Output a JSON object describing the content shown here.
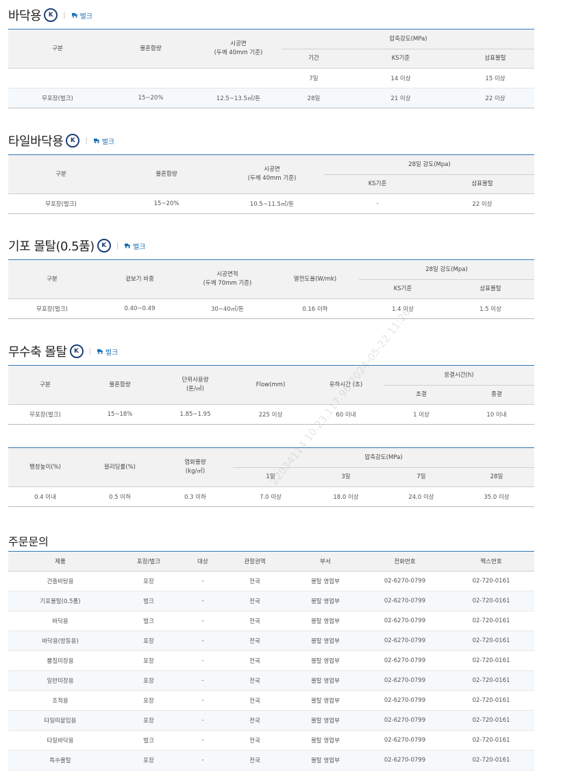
{
  "sections": {
    "floor": {
      "title": "바닥용",
      "ks": "K",
      "bulk": "벌크",
      "headers": {
        "category": "구분",
        "water": "물혼합량",
        "area_line1": "시공면",
        "area_line2": "(두께 40mm 기준)",
        "strength": "압축강도(MPa)",
        "period": "기간",
        "ks_std": "KS기준",
        "sampyo": "삼표몰탈"
      },
      "rows": [
        {
          "category": "",
          "water": "",
          "area": "",
          "period": "7일",
          "ks_std": "14 이상",
          "sampyo": "15 이상"
        },
        {
          "category": "무포장(벌크)",
          "water": "15~20%",
          "area": "12.5~13.5㎡/톤",
          "period": "28일",
          "ks_std": "21 이상",
          "sampyo": "22 이상"
        }
      ]
    },
    "tile_floor": {
      "title": "타일바닥용",
      "ks": "K",
      "bulk": "벌크",
      "headers": {
        "category": "구분",
        "water": "물혼합량",
        "area_line1": "시공면",
        "area_line2": "(두께 40mm 기준)",
        "strength": "28일 강도(Mpa)",
        "ks_std": "KS기준",
        "sampyo": "삼표몰탈"
      },
      "row": {
        "category": "무포장(벌크)",
        "water": "15~20%",
        "area": "10.5~11.5㎡/톤",
        "ks_std": "-",
        "sampyo": "22 이상"
      }
    },
    "base": {
      "title": "기포 몰탈(0.5품)",
      "ks": "K",
      "bulk": "벌크",
      "headers": {
        "category": "구분",
        "density": "겉보기 비중",
        "area_line1": "시공면적",
        "area_line2": "(두께 70mm 기준)",
        "conductivity": "열전도율(W/mk)",
        "strength": "28일 강도(Mpa)",
        "ks_std": "KS기준",
        "sampyo": "삼표몰탈"
      },
      "row": {
        "category": "무포장(벌크)",
        "density": "0.40~0.49",
        "area": "30~40㎡/톤",
        "conductivity": "0.16 이하",
        "ks_std": "1.4 이상",
        "sampyo": "1.5 이상"
      }
    },
    "nonshrink": {
      "title": "무수축 몰탈",
      "ks": "K",
      "bulk": "벌크",
      "headers": {
        "category": "구분",
        "water": "물혼합량",
        "usage_line1": "단위사용량",
        "usage_line2": "(톤/㎥)",
        "flow": "Flow(mm)",
        "flowtime": "유하시간 (초)",
        "setting": "응결시간(h)",
        "initial": "초결",
        "final": "종결"
      },
      "row": {
        "category": "무포장(벌크)",
        "water": "15~18%",
        "usage": "1.85~1.95",
        "flow": "225 이상",
        "flowtime": "60 이내",
        "initial": "1 이상",
        "final": "10 이내"
      },
      "headers2": {
        "expansion": "팽창높이(%)",
        "bleeding": "블리딩률(%)",
        "chloride_line1": "염화물량",
        "chloride_line2": "(kg/㎥)",
        "strength": "압축강도(MPa)",
        "d1": "1일",
        "d3": "3일",
        "d7": "7일",
        "d28": "28일"
      },
      "row2": {
        "expansion": "0.4 이내",
        "bleeding": "0.5 이하",
        "chloride": "0.3 이하",
        "d1": "7.0 이상",
        "d3": "18.0 이상",
        "d7": "24.0 이상",
        "d28": "35.0 이상"
      }
    }
  },
  "order": {
    "title": "주문문의",
    "headers": [
      "제품",
      "포장/벌크",
      "대상",
      "관할권역",
      "부서",
      "전화번호",
      "팩스번호"
    ],
    "rows": [
      [
        "건출비탕용",
        "포장",
        "-",
        "전국",
        "몰탈 영업부",
        "02-6270-0799",
        "02-720-0161"
      ],
      [
        "기포몰탈(0.5품)",
        "벌크",
        "-",
        "전국",
        "몰탈 영업부",
        "02-6270-0799",
        "02-720-0161"
      ],
      [
        "바닥용",
        "벌크",
        "-",
        "전국",
        "몰탈 영업부",
        "02-6270-0799",
        "02-720-0161"
      ],
      [
        "바닥용(방동용)",
        "포장",
        "-",
        "전국",
        "몰탈 영업부",
        "02-6270-0799",
        "02-720-0161"
      ],
      [
        "뿜칠미장용",
        "포장",
        "-",
        "전국",
        "몰탈 영업부",
        "02-6270-0799",
        "02-720-0161"
      ],
      [
        "일반미장용",
        "포장",
        "-",
        "전국",
        "몰탈 영업부",
        "02-6270-0799",
        "02-720-0161"
      ],
      [
        "조적용",
        "포장",
        "-",
        "전국",
        "몰탈 영업부",
        "02-6270-0799",
        "02-720-0161"
      ],
      [
        "타일떠붙임용",
        "포장",
        "-",
        "전국",
        "몰탈 영업부",
        "02-6270-0799",
        "02-720-0161"
      ],
      [
        "타일바닥용",
        "벌크",
        "-",
        "전국",
        "몰탈 영업부",
        "02-6270-0799",
        "02-720-0161"
      ],
      [
        "특수몰탈",
        "포장",
        "-",
        "전국",
        "몰탈 영업부",
        "02-6270-0799",
        "02-720-0161"
      ]
    ]
  },
  "watermark": "22034114 10.23.117.96 2024-05-22 11:26",
  "colors": {
    "accent": "#2f77b6",
    "ks": "#1d3f78",
    "bulk": "#1a6fb4"
  }
}
